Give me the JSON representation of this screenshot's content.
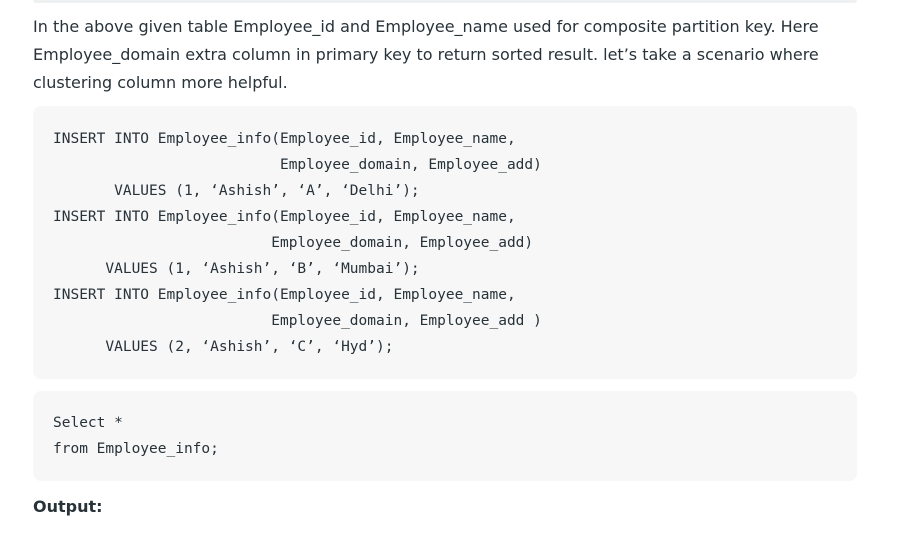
{
  "article": {
    "paragraph": "In the above given table Employee_id and Employee_name used for composite partition key. Here Employee_domain extra column in primary key to return sorted result. let’s take a scenario where clustering column more helpful.",
    "code_block_1": {
      "lines": [
        "INSERT INTO Employee_info(Employee_id, Employee_name,",
        "                          Employee_domain, Employee_add)",
        "       VALUES (1, ‘Ashish’, ‘A’, ‘Delhi’);",
        "INSERT INTO Employee_info(Employee_id, Employee_name,",
        "                         Employee_domain, Employee_add)",
        "      VALUES (1, ‘Ashish’, ‘B’, ‘Mumbai’);",
        "INSERT INTO Employee_info(Employee_id, Employee_name,",
        "                         Employee_domain, Employee_add )",
        "      VALUES (2, ‘Ashish’, ‘C’, ‘Hyd’);"
      ]
    },
    "code_block_2": {
      "lines": [
        "Select *",
        "from Employee_info;"
      ]
    },
    "output_label": "Output:"
  }
}
